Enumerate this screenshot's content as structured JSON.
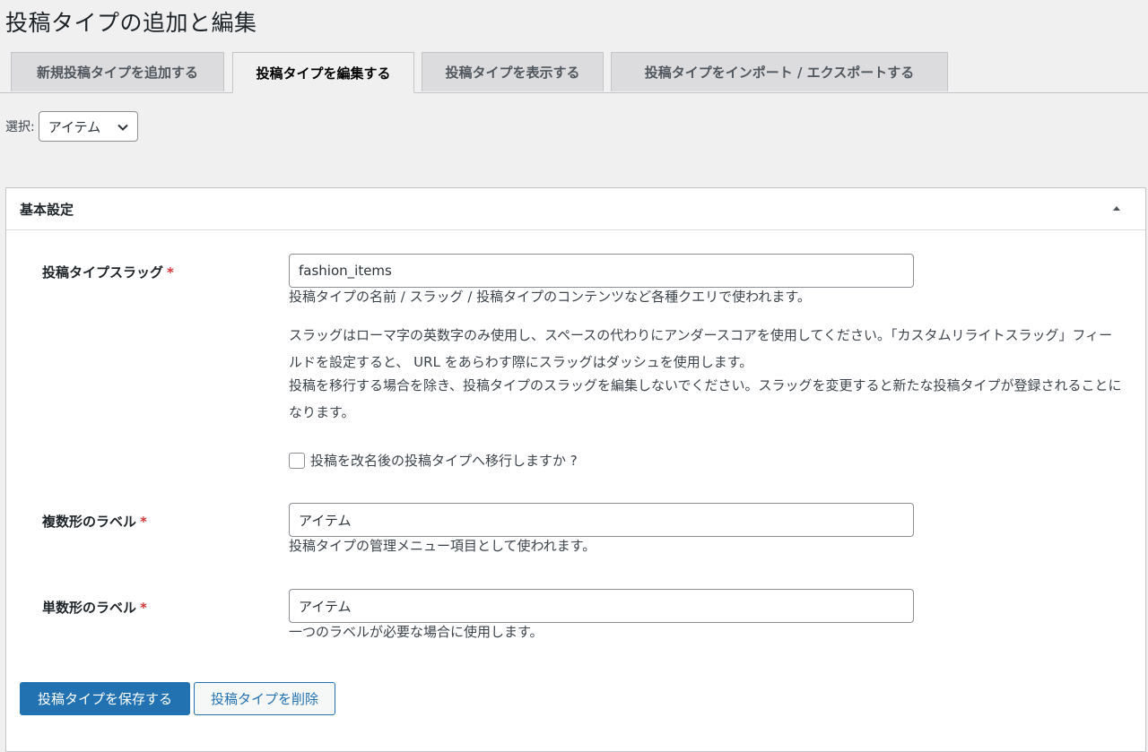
{
  "page": {
    "title": "投稿タイプの追加と編集"
  },
  "tabs": [
    {
      "label": "新規投稿タイプを追加する",
      "active": false
    },
    {
      "label": "投稿タイプを編集する",
      "active": true
    },
    {
      "label": "投稿タイプを表示する",
      "active": false
    },
    {
      "label": "投稿タイプをインポート / エクスポートする",
      "active": false
    }
  ],
  "selector": {
    "label": "選択:",
    "value": "アイテム"
  },
  "panel": {
    "title": "基本設定",
    "toggle_icon": "arrow-up-icon"
  },
  "fields": {
    "slug": {
      "label": "投稿タイプスラッグ",
      "required_mark": "*",
      "value": "fashion_items",
      "desc1": "投稿タイプの名前 / スラッグ / 投稿タイプのコンテンツなど各種クエリで使われます。",
      "desc2": "スラッグはローマ字の英数字のみ使用し、スペースの代わりにアンダースコアを使用してください。「カスタムリライトスラッグ」フィールドを設定すると、 URL をあらわす際にスラッグはダッシュを使用します。",
      "desc3": "投稿を移行する場合を除き、投稿タイプのスラッグを編集しないでください。スラッグを変更すると新たな投稿タイプが登録されることになります。",
      "checkbox_label": "投稿を改名後の投稿タイプへ移行しますか ?",
      "checkbox_checked": false
    },
    "plural": {
      "label": "複数形のラベル",
      "required_mark": "*",
      "value": "アイテム",
      "desc": "投稿タイプの管理メニュー項目として使われます。"
    },
    "singular": {
      "label": "単数形のラベル",
      "required_mark": "*",
      "value": "アイテム",
      "desc": "一つのラベルが必要な場合に使用します。"
    }
  },
  "actions": {
    "save_label": "投稿タイプを保存する",
    "delete_label": "投稿タイプを削除"
  },
  "colors": {
    "primary": "#2271b1",
    "required": "#d63638",
    "background": "#f0f0f1"
  }
}
